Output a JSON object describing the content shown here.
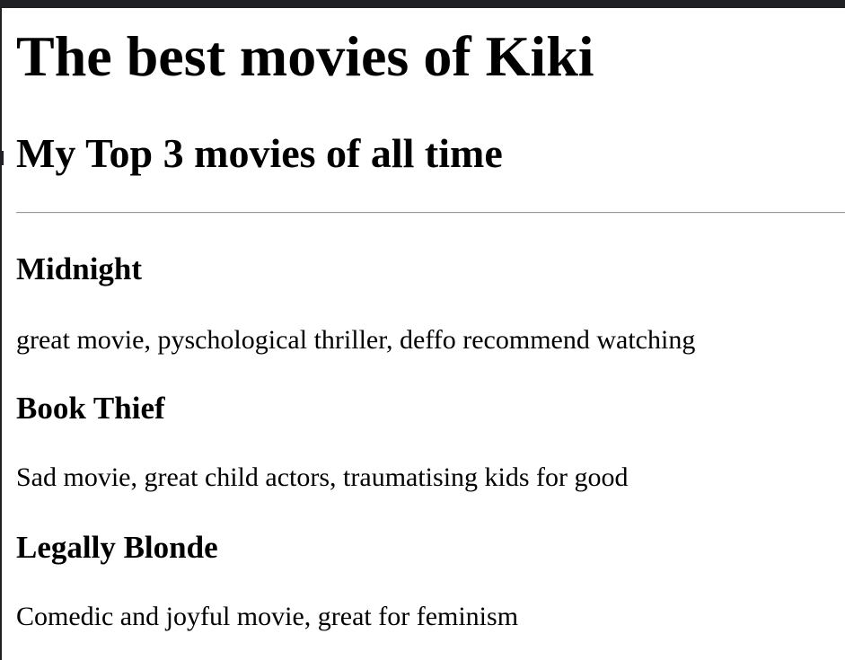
{
  "page": {
    "title": "The best movies of Kiki",
    "subtitle": "My Top 3 movies of all time"
  },
  "movies": [
    {
      "title": "Midnight",
      "description": "great movie, pyschological thriller, deffo recommend watching"
    },
    {
      "title": "Book Thief",
      "description": "Sad movie, great child actors, traumatising kids for good"
    },
    {
      "title": "Legally Blonde",
      "description": "Comedic and joyful movie, great for feminism"
    }
  ]
}
